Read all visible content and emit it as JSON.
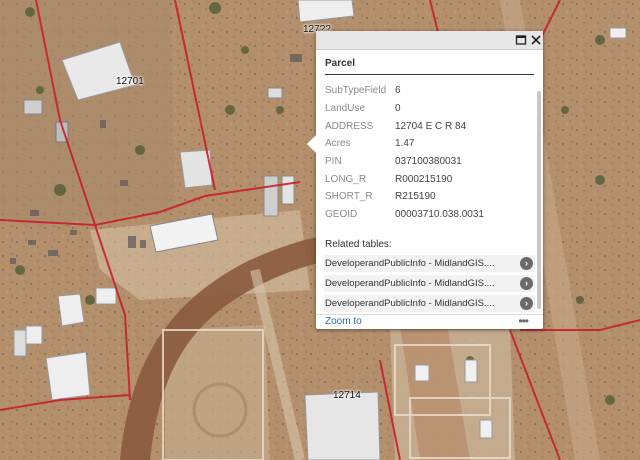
{
  "map": {
    "parcel_labels": [
      "12701",
      "127??",
      "12714"
    ],
    "colors": {
      "ground": "#b38f6c",
      "parcel_line": "#c8202a",
      "road": "#8a5a3e"
    }
  },
  "popup": {
    "title": "Parcel",
    "attributes": [
      {
        "key": "SubTypeField",
        "value": "6"
      },
      {
        "key": "LandUse",
        "value": "0"
      },
      {
        "key": "ADDRESS",
        "value": "12704 E C R 84"
      },
      {
        "key": "Acres",
        "value": "1.47"
      },
      {
        "key": "PIN",
        "value": "037100380031"
      },
      {
        "key": "LONG_R",
        "value": "R000215190"
      },
      {
        "key": "SHORT_R",
        "value": "R215190"
      },
      {
        "key": "GEOID",
        "value": "00003710.038.0031"
      }
    ],
    "related_title": "Related tables:",
    "related_items": [
      "DeveloperandPublicInfo - MidlandGIS....",
      "DeveloperandPublicInfo - MidlandGIS....",
      "DeveloperandPublicInfo - MidlandGIS...."
    ],
    "zoom_label": "Zoom to",
    "more_label": "•••",
    "icons": {
      "maximize": "maximize-icon",
      "close": "close-icon",
      "chevron": "chevron-right-icon"
    }
  }
}
